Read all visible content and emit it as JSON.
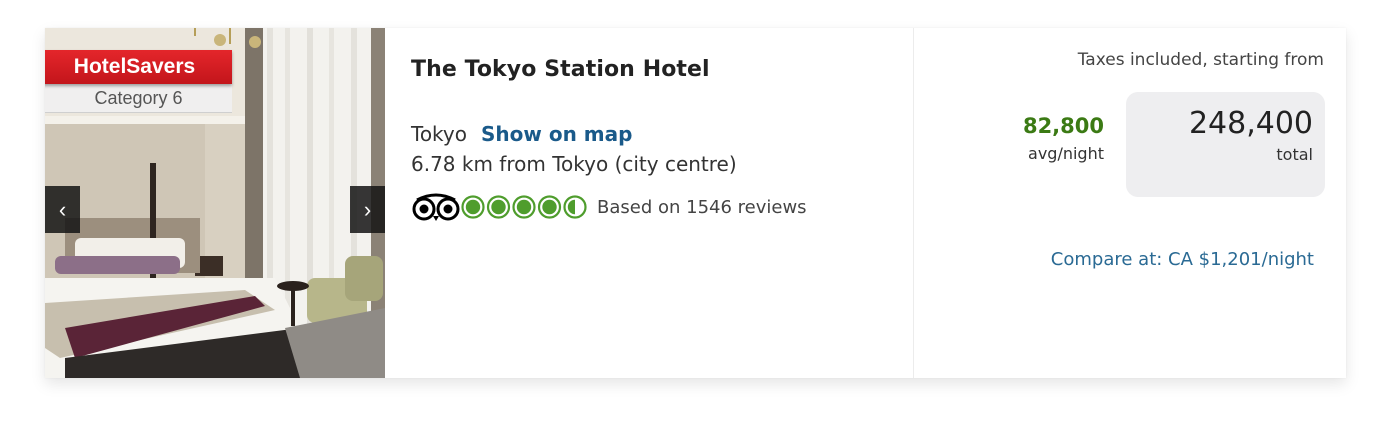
{
  "badge": {
    "brand": "HotelSavers",
    "category": "Category 6"
  },
  "gallery": {
    "prev_icon": "chevron-left-icon",
    "next_icon": "chevron-right-icon",
    "prev_glyph": "‹",
    "next_glyph": "›"
  },
  "hotel": {
    "name": "The Tokyo Station Hotel",
    "city": "Tokyo",
    "map_link": "Show on map",
    "distance": "6.78 km from Tokyo (city centre)"
  },
  "rating": {
    "icon": "tripadvisor-owl-icon",
    "bubbles": 4.5,
    "max_bubbles": 5,
    "reviews_text": "Based on 1546 reviews",
    "color": "#4f9d2d"
  },
  "price": {
    "taxes_label": "Taxes included, starting from",
    "avg_price": "82,800",
    "avg_label": "avg/night",
    "total_price": "248,400",
    "total_label": "total",
    "compare_text": "Compare at: CA $1,201/night"
  },
  "colors": {
    "brand_red": "#d41c22",
    "link_blue": "#1a5a8a",
    "price_green": "#3b7a14",
    "total_box_bg": "#eeeef0"
  }
}
